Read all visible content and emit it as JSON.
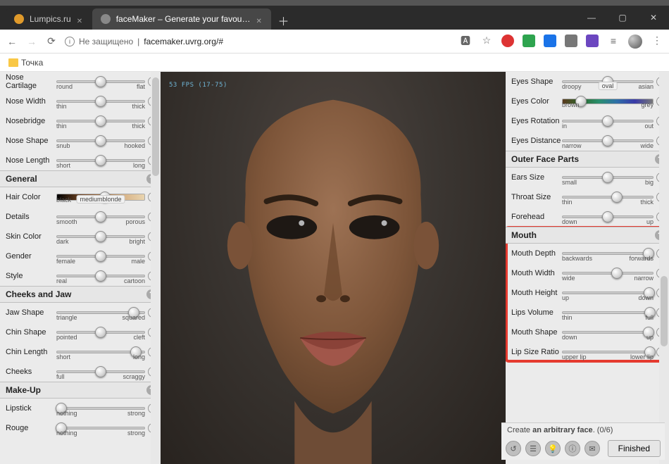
{
  "browser": {
    "tabs": [
      {
        "title": "Lumpics.ru",
        "fav": "#e09a2b",
        "active": false
      },
      {
        "title": "faceMaker – Generate your favou…",
        "fav": "#888",
        "active": true
      }
    ],
    "nav": {
      "back": "←",
      "forward": "→",
      "reload": "⟳"
    },
    "address": {
      "secure_label": "Не защищено",
      "url": "facemaker.uvrg.org/#"
    },
    "bookmark": {
      "label": "Точка"
    }
  },
  "viewport": {
    "fps": "53 FPS (17-75)"
  },
  "left": {
    "nose": [
      {
        "name": "Nose Cartilage",
        "min": "round",
        "max": "flat",
        "pos": 50
      },
      {
        "name": "Nose Width",
        "min": "thin",
        "max": "thick",
        "pos": 50
      },
      {
        "name": "Nosebridge",
        "min": "thin",
        "max": "thick",
        "pos": 50
      },
      {
        "name": "Nose Shape",
        "min": "snub",
        "max": "hooked",
        "pos": 50
      },
      {
        "name": "Nose Length",
        "min": "short",
        "max": "long",
        "pos": 50
      }
    ],
    "general": {
      "title": "General",
      "rows": [
        {
          "name": "Hair Color",
          "min": "black",
          "max": "",
          "pos": 55,
          "grad": "hair",
          "tag": "mediumblonde"
        },
        {
          "name": "Details",
          "min": "smooth",
          "max": "porous",
          "pos": 50
        },
        {
          "name": "Skin Color",
          "min": "dark",
          "max": "bright",
          "pos": 50
        },
        {
          "name": "Gender",
          "min": "female",
          "max": "male",
          "pos": 50
        },
        {
          "name": "Style",
          "min": "real",
          "max": "cartoon",
          "pos": 50
        }
      ]
    },
    "cheeks": {
      "title": "Cheeks and Jaw",
      "rows": [
        {
          "name": "Jaw Shape",
          "min": "triangle",
          "max": "squared",
          "pos": 88
        },
        {
          "name": "Chin Shape",
          "min": "pointed",
          "max": "cleft",
          "pos": 50
        },
        {
          "name": "Chin Length",
          "min": "short",
          "max": "long",
          "pos": 90
        },
        {
          "name": "Cheeks",
          "min": "full",
          "max": "scraggy",
          "pos": 50
        }
      ]
    },
    "makeup": {
      "title": "Make-Up",
      "rows": [
        {
          "name": "Lipstick",
          "min": "nothing",
          "max": "strong",
          "pos": 5
        },
        {
          "name": "Rouge",
          "min": "nothing",
          "max": "strong",
          "pos": 5
        }
      ]
    }
  },
  "right": {
    "eyes": [
      {
        "name": "Eyes Shape",
        "min": "droopy",
        "max": "asian",
        "pos": 50,
        "tag": "oval"
      },
      {
        "name": "Eyes Color",
        "min": "brown",
        "max": "grey",
        "pos": 20,
        "grad": "eye"
      },
      {
        "name": "Eyes Rotation",
        "min": "in",
        "max": "out",
        "pos": 50
      },
      {
        "name": "Eyes Distance",
        "min": "narrow",
        "max": "wide",
        "pos": 50
      }
    ],
    "outer": {
      "title": "Outer Face Parts",
      "rows": [
        {
          "name": "Ears Size",
          "min": "small",
          "max": "big",
          "pos": 50
        },
        {
          "name": "Throat Size",
          "min": "thin",
          "max": "thick",
          "pos": 60
        },
        {
          "name": "Forehead",
          "min": "down",
          "max": "up",
          "pos": 50
        }
      ]
    },
    "mouth": {
      "title": "Mouth",
      "rows": [
        {
          "name": "Mouth Depth",
          "min": "backwards",
          "max": "forwards",
          "pos": 95
        },
        {
          "name": "Mouth Width",
          "min": "wide",
          "max": "narrow",
          "pos": 60
        },
        {
          "name": "Mouth Height",
          "min": "up",
          "max": "down",
          "pos": 96
        },
        {
          "name": "Lips Volume",
          "min": "thin",
          "max": "full",
          "pos": 97
        },
        {
          "name": "Mouth Shape",
          "min": "down",
          "max": "up",
          "pos": 95
        },
        {
          "name": "Lip Size Ratio",
          "min": "upper lip",
          "max": "lower lip",
          "pos": 97
        }
      ]
    }
  },
  "bottom": {
    "text_pre": "Create ",
    "text_bold": "an arbitrary face",
    "text_post": ". (0/6)",
    "finished": "Finished"
  }
}
